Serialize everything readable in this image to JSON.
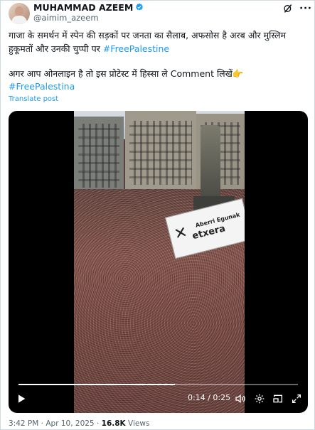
{
  "author": {
    "name": "MUHAMMAD AZEEM",
    "handle": "@aimim_azeem"
  },
  "post": {
    "line1": "गाजा के समर्थन में स्पेन की सड़कों पर जनता का सैलाब, अफसोस है अरब और मुस्लिम",
    "line2_text": "हुकूमतों और उनकी चुप्पी पर ",
    "line2_tag": "#FreePalestine",
    "line3": "अगर आप ओनलाइन है तो इस प्रोटेस्ट में हिस्सा ले Comment लिखें👉",
    "line4_tag": "#FreePalestina",
    "translate_label": "Translate post"
  },
  "video": {
    "banner_small": "Aberri Egunak",
    "banner_big": "etxera",
    "current_time": "0:14",
    "separator": "/",
    "duration": "0:25",
    "progress": 0.56
  },
  "footer": {
    "time": "3:42 PM",
    "dot": "·",
    "date": "Apr 10, 2025",
    "views_count": "16.8K",
    "views_label": "Views"
  },
  "colors": {
    "accent": "#1d9bf0",
    "muted": "#536471",
    "text": "#0f1419"
  },
  "icons": {
    "verified": "verified-badge-icon",
    "grok": "grok-icon",
    "more": "more-icon",
    "play": "play-icon",
    "volume": "volume-icon",
    "settings": "settings-icon",
    "pip": "picture-in-picture-icon",
    "fullscreen": "fullscreen-icon"
  }
}
